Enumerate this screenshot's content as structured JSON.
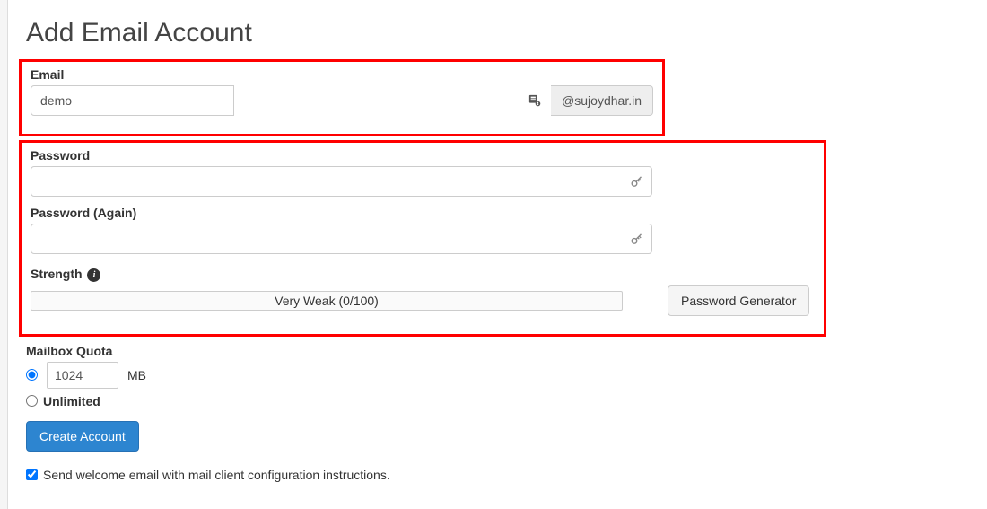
{
  "page": {
    "title": "Add Email Account"
  },
  "email": {
    "label": "Email",
    "value": "demo",
    "domain": "@sujoydhar.in"
  },
  "password": {
    "label": "Password",
    "again_label": "Password (Again)"
  },
  "strength": {
    "label": "Strength",
    "text": "Very Weak (0/100)",
    "generator_button": "Password Generator"
  },
  "quota": {
    "label": "Mailbox Quota",
    "value": "1024",
    "unit": "MB",
    "unlimited_label": "Unlimited"
  },
  "actions": {
    "create_button": "Create Account"
  },
  "welcome": {
    "label": "Send welcome email with mail client configuration instructions."
  }
}
